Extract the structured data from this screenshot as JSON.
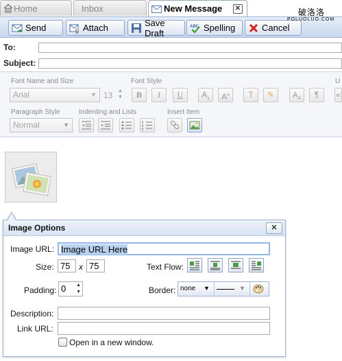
{
  "tabs": [
    {
      "label": "Home"
    },
    {
      "label": "Inbox"
    },
    {
      "label": "New Message"
    }
  ],
  "watermark": {
    "line1": "破洛洛",
    "line2": "POLUOLUO.COM"
  },
  "toolbar": {
    "send": "Send",
    "attach": "Attach",
    "save_draft": "Save Draft",
    "spelling": "Spelling",
    "spelling_icon_text": "ABC",
    "cancel": "Cancel"
  },
  "compose": {
    "to_label": "To:",
    "to_value": "",
    "subject_label": "Subject:",
    "subject_value": ""
  },
  "format": {
    "font_name_label": "Font Name and Size",
    "font_style_label": "Font Style",
    "font_name_value": "Arial",
    "font_size_value": "13",
    "bold": "B",
    "italic": "I",
    "underline": "U",
    "paragraph_style_label": "Paragraph Style",
    "paragraph_value": "Normal",
    "indent_label": "Indenting and Lists",
    "insert_item_label": "Insert Item",
    "cut_label": "U"
  },
  "image_options": {
    "title": "Image Options",
    "url_label": "Image URL:",
    "url_value": "Image URL Here",
    "size_label": "Size:",
    "width": "75",
    "times": "x",
    "height": "75",
    "text_flow_label": "Text Flow:",
    "padding_label": "Padding:",
    "padding_value": "0",
    "border_label": "Border:",
    "border_style": "none",
    "description_label": "Description:",
    "description_value": "",
    "link_label": "Link URL:",
    "link_value": "",
    "new_window_label": "Open in a new window."
  }
}
